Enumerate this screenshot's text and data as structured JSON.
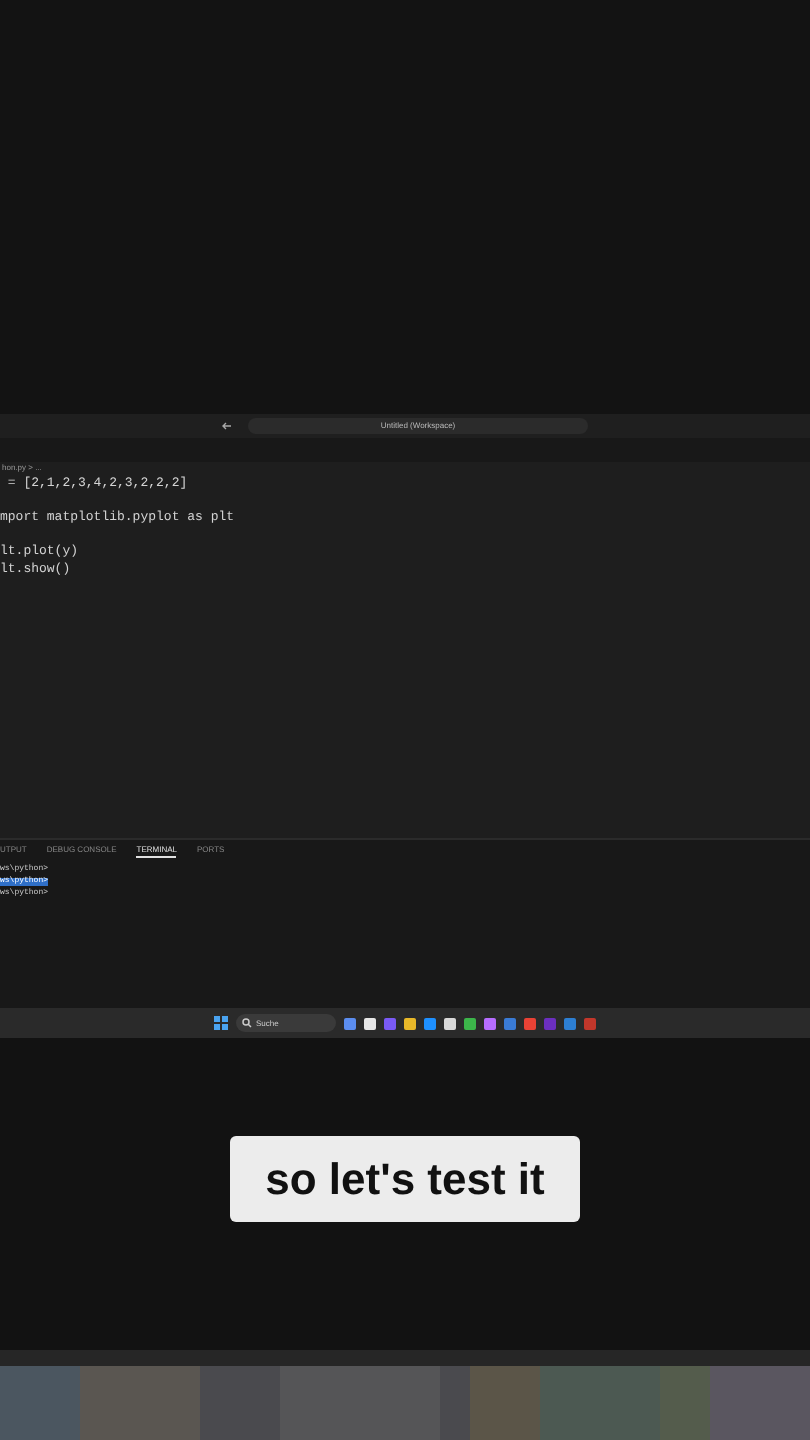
{
  "title_bar": {
    "search": "Untitled (Workspace)"
  },
  "breadcrumb": "hon.py > ...",
  "editor": {
    "lines": [
      {
        "kind": "code",
        "text": " = [2,1,2,3,4,2,3,2,2,2]"
      },
      {
        "kind": "blank"
      },
      {
        "kind": "code",
        "text": "mport matplotlib.pyplot as plt"
      },
      {
        "kind": "blank"
      },
      {
        "kind": "code",
        "text": "lt.plot(y)"
      },
      {
        "kind": "code",
        "text": "lt.show()"
      }
    ]
  },
  "panel": {
    "tabs": [
      {
        "label": "UTPUT",
        "selected": false
      },
      {
        "label": "DEBUG CONSOLE",
        "selected": false
      },
      {
        "label": "TERMINAL",
        "selected": true
      },
      {
        "label": "PORTS",
        "selected": false
      }
    ],
    "terminal": [
      {
        "text": "ws\\python>",
        "selected": false
      },
      {
        "text": "ws\\python>",
        "selected": true
      },
      {
        "text": "ws\\python>",
        "selected": false
      }
    ]
  },
  "taskbar": {
    "search": "Suche"
  },
  "caption": "so let's test it"
}
